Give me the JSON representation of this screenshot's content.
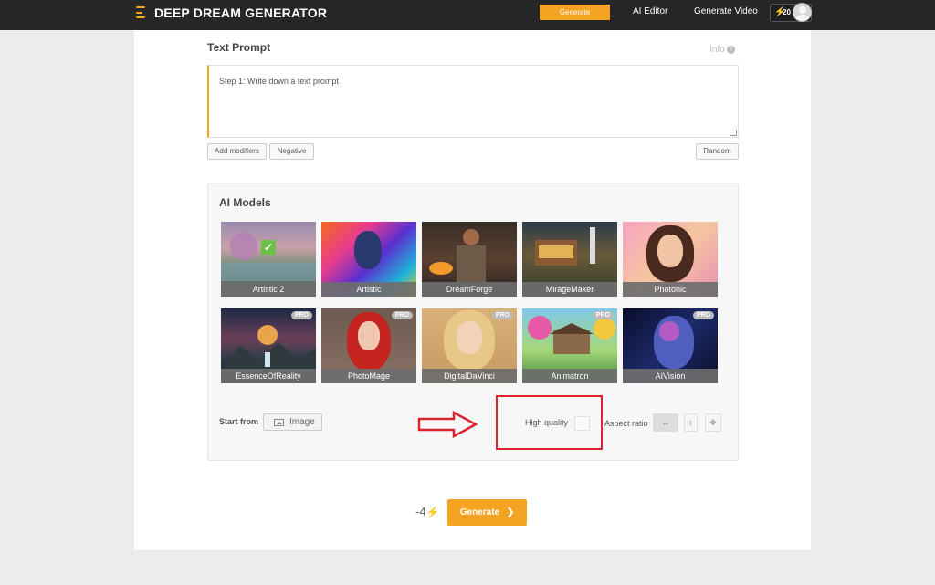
{
  "header": {
    "brand": "DEEP DREAM GENERATOR",
    "nav_generate": "Generate",
    "nav_ai_editor": "AI Editor",
    "nav_generate_video": "Generate Video",
    "credits": "20",
    "accent_color": "#f4a322"
  },
  "prompt": {
    "title": "Text Prompt",
    "info_label": "Info",
    "placeholder": "Step 1: Write down a text prompt",
    "add_modifiers": "Add modifiers",
    "negative": "Negative",
    "random": "Random"
  },
  "models": {
    "title": "AI Models",
    "pro_badge": "PRO",
    "items": [
      {
        "label": "Artistic 2",
        "selected": true,
        "pro": false
      },
      {
        "label": "Artistic",
        "pro": false
      },
      {
        "label": "DreamForge",
        "pro": false
      },
      {
        "label": "MirageMaker",
        "pro": false
      },
      {
        "label": "Photonic",
        "pro": false
      },
      {
        "label": "EssenceOfReality",
        "pro": true
      },
      {
        "label": "PhotoMage",
        "pro": true
      },
      {
        "label": "DigitalDaVinci",
        "pro": true
      },
      {
        "label": "Animatron",
        "pro": true
      },
      {
        "label": "AIVision",
        "pro": true
      }
    ]
  },
  "options": {
    "start_from": "Start from",
    "image_button": "Image",
    "high_quality": "High quality",
    "aspect_ratio": "Aspect ratio"
  },
  "footer": {
    "cost": "-4",
    "generate": "Generate"
  }
}
